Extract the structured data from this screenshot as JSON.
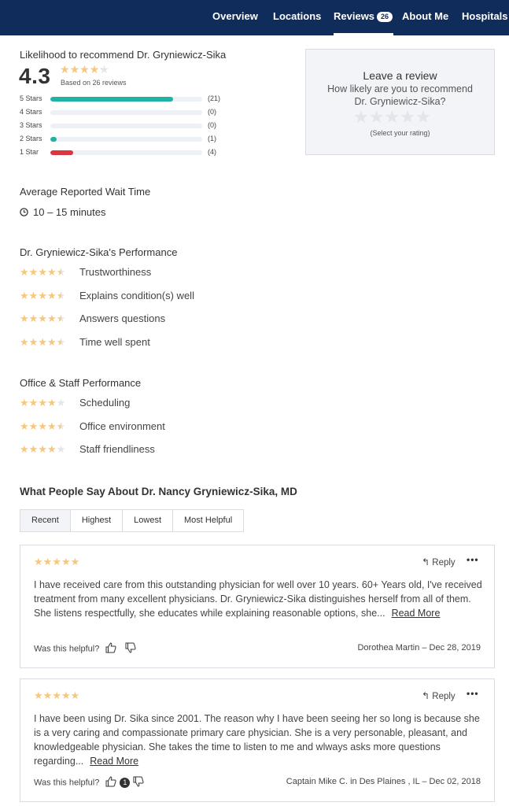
{
  "nav": {
    "tabs": [
      {
        "label": "Overview"
      },
      {
        "label": "Locations"
      },
      {
        "label": "Reviews",
        "badge": "26"
      },
      {
        "label": "About Me"
      },
      {
        "label": "Hospitals"
      }
    ]
  },
  "summary": {
    "heading": "Likelihood to recommend Dr. Gryniewicz-Sika",
    "score": "4.3",
    "score_value": 4.3,
    "based_on": "Based on 26 reviews",
    "distribution": [
      {
        "label": "5 Stars",
        "count": "(21)",
        "fraction": 0.81
      },
      {
        "label": "4 Stars",
        "count": "(0)",
        "fraction": 0
      },
      {
        "label": "3 Stars",
        "count": "(0)",
        "fraction": 0
      },
      {
        "label": "2 Stars",
        "count": "(1)",
        "fraction": 0.04
      },
      {
        "label": "1 Star",
        "count": "(4)",
        "fraction": 0.15
      }
    ]
  },
  "colors": {
    "nav_bg": "#0f2c5a",
    "star_gold": "#f6c77c",
    "star_empty": "#e3e5e8",
    "bar_high": "#1fb2a6",
    "bar_low": "#d9363e"
  },
  "leave_review": {
    "title": "Leave a review",
    "question": "How likely are you to recommend Dr. Gryniewicz-Sika?",
    "hint": "(Select your rating)"
  },
  "wait_time": {
    "heading": "Average Reported Wait Time",
    "icon": "clock-icon",
    "value": "10 – 15 minutes"
  },
  "performance": {
    "heading": "Dr. Gryniewicz-Sika's Performance",
    "items": [
      {
        "label": "Trustworthiness",
        "rating": 4.5
      },
      {
        "label": "Explains condition(s) well",
        "rating": 4.5
      },
      {
        "label": "Answers questions",
        "rating": 4.5
      },
      {
        "label": "Time well spent",
        "rating": 4.5
      }
    ]
  },
  "office": {
    "heading": "Office & Staff Performance",
    "items": [
      {
        "label": "Scheduling",
        "rating": 4
      },
      {
        "label": "Office environment",
        "rating": 4.5
      },
      {
        "label": "Staff friendliness",
        "rating": 4
      }
    ]
  },
  "reviews_section": {
    "heading": "What People Say About Dr. Nancy Gryniewicz-Sika, MD",
    "sort_tabs": [
      "Recent",
      "Highest",
      "Lowest",
      "Most Helpful"
    ],
    "reviews": [
      {
        "rating": 5,
        "reply": "Reply",
        "more": "•••",
        "text": "I have received care from this outstanding physician for well over 10 years. 60+ Years old, I've received treatment from many excellent physicians. Dr. Gryniewicz-Sika distinguishes herself from all of them. She listens respectfully, she educates while explaining reasonable options, she...",
        "read_more": "Read More",
        "helpful": "Was this helpful?",
        "helpful_count": "",
        "author": "Dorothea Martin – Dec 28, 2019"
      },
      {
        "rating": 5,
        "reply": "Reply",
        "more": "•••",
        "text": "I have been using Dr. Sika since 2001. The reason why I have been seeing her so long is because she is a very caring and compassionate primary care physician. She is a very personable, pleasant, and knowledgeable physician. She takes the time to listen to me and wlways asks more questions regarding...",
        "read_more": "Read More",
        "helpful": "Was this helpful?",
        "helpful_count": "1",
        "author": "Captain Mike C. in Des Plaines , IL – Dec 02, 2018"
      }
    ]
  }
}
